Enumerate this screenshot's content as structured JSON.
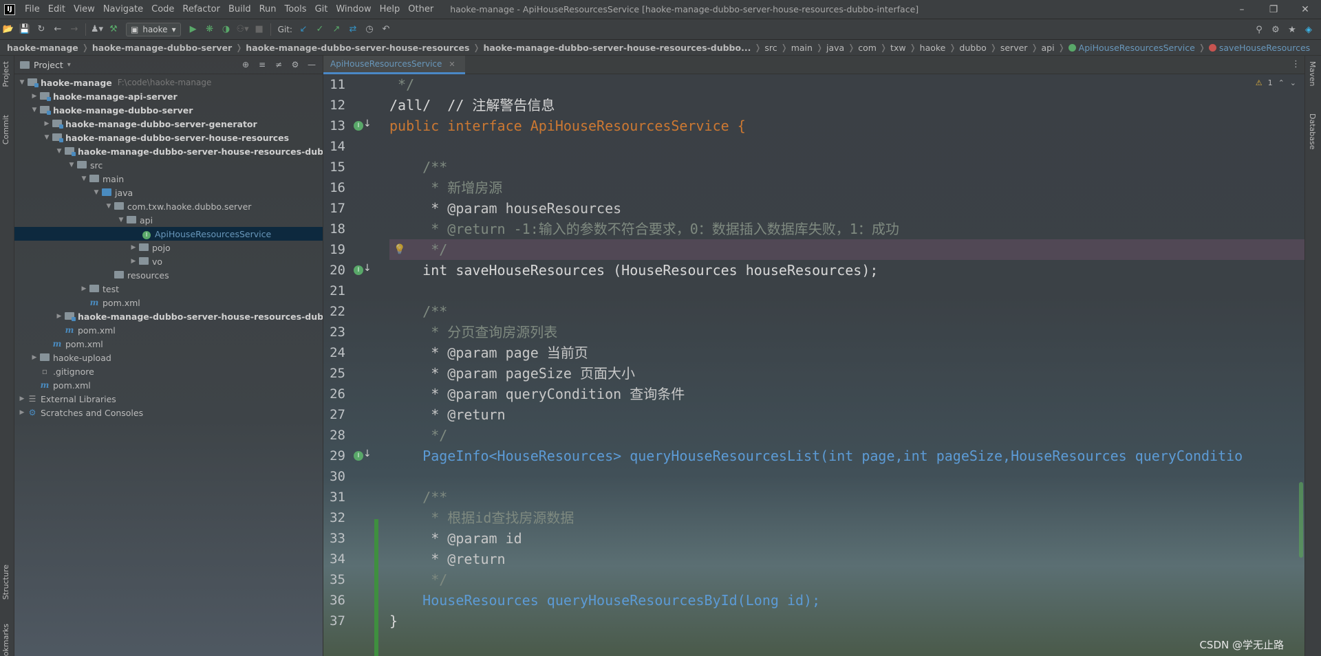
{
  "app": {
    "logo_text": "IJ",
    "window_title": "haoke-manage - ApiHouseResourcesService [haoke-manage-dubbo-server-house-resources-dubbo-interface]"
  },
  "menu": [
    "File",
    "Edit",
    "View",
    "Navigate",
    "Code",
    "Refactor",
    "Build",
    "Run",
    "Tools",
    "Git",
    "Window",
    "Help",
    "Other"
  ],
  "toolbar": {
    "run_config": "haoke",
    "git_label": "Git:"
  },
  "breadcrumbs": [
    "haoke-manage",
    "haoke-manage-dubbo-server",
    "haoke-manage-dubbo-server-house-resources",
    "haoke-manage-dubbo-server-house-resources-dubbo...",
    "src",
    "main",
    "java",
    "com",
    "txw",
    "haoke",
    "dubbo",
    "server",
    "api",
    "ApiHouseResourcesService",
    "saveHouseResources"
  ],
  "left_stripe": {
    "project": "Project",
    "commit": "Commit",
    "structure": "Structure",
    "bookmarks": "Bookmarks"
  },
  "right_stripe": {
    "maven": "Maven",
    "database": "Database"
  },
  "project_panel": {
    "title": "Project"
  },
  "tree": [
    {
      "label": "haoke-manage",
      "path": "F:\\code\\haoke-manage",
      "bold": true
    },
    {
      "label": "haoke-manage-api-server",
      "bold": true
    },
    {
      "label": "haoke-manage-dubbo-server",
      "bold": true
    },
    {
      "label": "haoke-manage-dubbo-server-generator",
      "bold": true
    },
    {
      "label": "haoke-manage-dubbo-server-house-resources",
      "bold": true
    },
    {
      "label": "haoke-manage-dubbo-server-house-resources-dubbo-interface",
      "bold": true
    },
    {
      "label": "src"
    },
    {
      "label": "main"
    },
    {
      "label": "java"
    },
    {
      "label": "com.txw.haoke.dubbo.server"
    },
    {
      "label": "api"
    },
    {
      "label": "ApiHouseResourcesService",
      "selected": true
    },
    {
      "label": "pojo"
    },
    {
      "label": "vo"
    },
    {
      "label": "resources"
    },
    {
      "label": "test"
    },
    {
      "label": "pom.xml"
    },
    {
      "label": "haoke-manage-dubbo-server-house-resources-dubbo-service",
      "bold": true
    },
    {
      "label": "pom.xml"
    },
    {
      "label": "pom.xml"
    },
    {
      "label": "haoke-upload"
    },
    {
      "label": ".gitignore"
    },
    {
      "label": "pom.xml"
    },
    {
      "label": "External Libraries"
    },
    {
      "label": "Scratches and Consoles"
    }
  ],
  "editor": {
    "tab_label": "ApiHouseResourcesService",
    "warning_count": "1",
    "lines": [
      {
        "n": "11",
        "text": " */"
      },
      {
        "n": "12",
        "text": "/all/  // 注解警告信息"
      },
      {
        "n": "13",
        "text": "public interface ApiHouseResourcesService {"
      },
      {
        "n": "14",
        "text": ""
      },
      {
        "n": "15",
        "text": "    /**"
      },
      {
        "n": "16",
        "text": "     * 新增房源"
      },
      {
        "n": "17",
        "text": "     * @param houseResources"
      },
      {
        "n": "18",
        "text": "     * @return -1:输入的参数不符合要求，0：数据插入数据库失败，1：成功"
      },
      {
        "n": "19",
        "text": "     */"
      },
      {
        "n": "20",
        "text": "    int saveHouseResources (HouseResources houseResources);"
      },
      {
        "n": "21",
        "text": ""
      },
      {
        "n": "22",
        "text": "    /**"
      },
      {
        "n": "23",
        "text": "     * 分页查询房源列表"
      },
      {
        "n": "24",
        "text": "     * @param page 当前页"
      },
      {
        "n": "25",
        "text": "     * @param pageSize 页面大小"
      },
      {
        "n": "26",
        "text": "     * @param queryCondition 查询条件"
      },
      {
        "n": "27",
        "text": "     * @return"
      },
      {
        "n": "28",
        "text": "     */"
      },
      {
        "n": "29",
        "text": "    PageInfo<HouseResources> queryHouseResourcesList(int page,int pageSize,HouseResources queryConditio"
      },
      {
        "n": "30",
        "text": ""
      },
      {
        "n": "31",
        "text": "    /**"
      },
      {
        "n": "32",
        "text": "     * 根据id查找房源数据"
      },
      {
        "n": "33",
        "text": "     * @param id"
      },
      {
        "n": "34",
        "text": "     * @return"
      },
      {
        "n": "35",
        "text": "     */"
      },
      {
        "n": "36",
        "text": "    HouseResources queryHouseResourcesById(Long id);"
      },
      {
        "n": "37",
        "text": "}"
      }
    ]
  },
  "watermark": "CSDN @学无止路",
  "colors": {
    "accent": "#4a88c7",
    "keyword": "#cc7832",
    "interface_icon": "#59a869",
    "selection": "#0d293e"
  }
}
